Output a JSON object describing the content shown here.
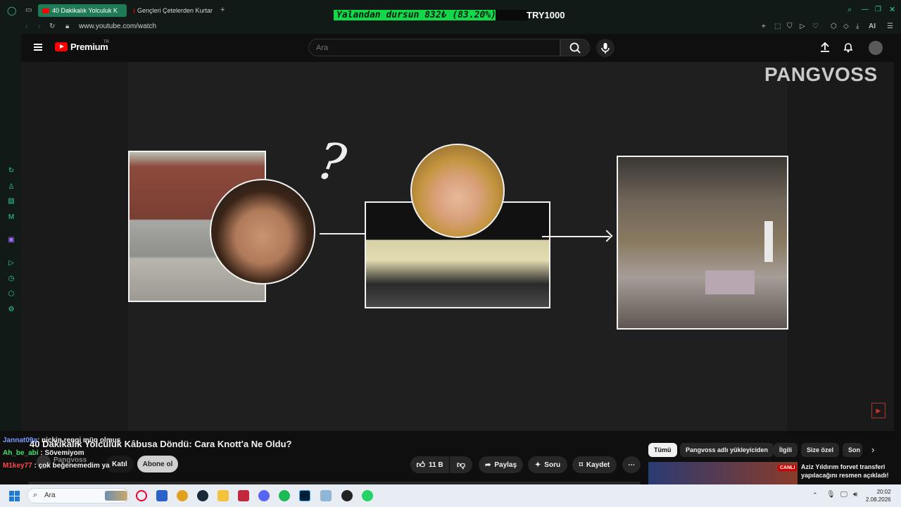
{
  "browser": {
    "tabs": [
      {
        "label": "40 Dakikalık Yolculuk K",
        "active": true
      },
      {
        "label": "Gençleri Çetelerden Kurtar",
        "active": false
      }
    ],
    "new_tab": "+",
    "url": "www.youtube.com/watch",
    "ai_label": "AI"
  },
  "stream_overlay": {
    "text": "Yalandan dursun  832₺ (83.20%)",
    "progress": 0.832,
    "goal": "TRY1000"
  },
  "youtube": {
    "logo_text": "Premium",
    "region": "TR",
    "search_placeholder": "Ara",
    "video": {
      "watermark": "PANGVOSS",
      "title": "40 Dakikalık Yolculuk Kâbusa Döndü: Cara Knott'a Ne Oldu?",
      "channel": "Pangvoss",
      "join_label": "Katıl",
      "subscribe_label": "Abone ol",
      "like_count": "11 B",
      "share_label": "Paylaş",
      "ask_label": "Soru",
      "save_label": "Kaydet"
    },
    "chips": [
      {
        "label": "Tümü",
        "active": true
      },
      {
        "label": "Pangvoss adlı yükleyiciden",
        "active": false
      },
      {
        "label": "İlgili",
        "active": false
      },
      {
        "label": "Size özel",
        "active": false
      },
      {
        "label": "Son",
        "active": false
      }
    ],
    "recommended": {
      "badge": "CANLI",
      "title_line1": "Aziz Yıldırım forvet transferi",
      "title_line2": "yapılacağını resmen açıkladı!"
    }
  },
  "chat_overlay": [
    {
      "user": "Jannat09a",
      "sep": ": ",
      "msg": "nickin rengi müq olmus",
      "color": "#7b9bff"
    },
    {
      "user": "Ah_be_abi",
      "sep": " : ",
      "msg": "Sövemiyom",
      "color": "#3fe36a"
    },
    {
      "user": "M1key77",
      "sep": " : ",
      "msg": "çok beğenemedim ya",
      "color": "#ff4a4a"
    }
  ],
  "taskbar": {
    "search_label": "Ara",
    "time": "20:02",
    "date": "2.08.2026"
  },
  "colors": {
    "accent_green": "#1e7a57",
    "youtube_red": "#ff0000",
    "progress_green": "#12d94a"
  }
}
